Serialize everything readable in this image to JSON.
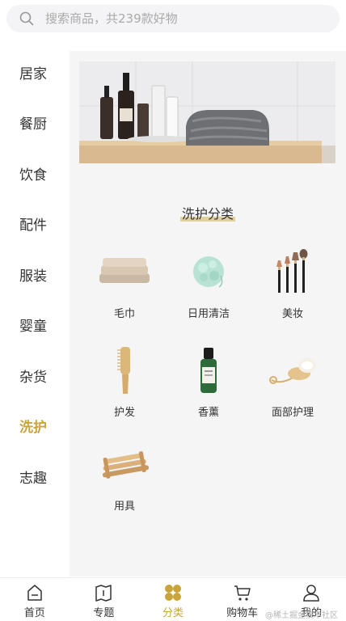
{
  "search": {
    "placeholder": "搜索商品，共239款好物"
  },
  "sidebar": {
    "items": [
      {
        "label": "居家",
        "active": false
      },
      {
        "label": "餐厨",
        "active": false
      },
      {
        "label": "饮食",
        "active": false
      },
      {
        "label": "配件",
        "active": false
      },
      {
        "label": "服装",
        "active": false
      },
      {
        "label": "婴童",
        "active": false
      },
      {
        "label": "杂货",
        "active": false
      },
      {
        "label": "洗护",
        "active": true
      },
      {
        "label": "志趣",
        "active": false
      }
    ]
  },
  "main": {
    "section_title": "洗护分类",
    "subcategories": [
      {
        "label": "毛巾",
        "icon": "towel-icon"
      },
      {
        "label": "日用清洁",
        "icon": "bath-sponge-icon"
      },
      {
        "label": "美妆",
        "icon": "makeup-brushes-icon"
      },
      {
        "label": "护发",
        "icon": "comb-icon"
      },
      {
        "label": "香薰",
        "icon": "essential-oil-icon"
      },
      {
        "label": "面部护理",
        "icon": "face-brush-icon"
      },
      {
        "label": "用具",
        "icon": "soap-dish-icon"
      }
    ]
  },
  "tabbar": {
    "tabs": [
      {
        "label": "首页",
        "icon": "home-icon",
        "active": false
      },
      {
        "label": "专题",
        "icon": "topic-book-icon",
        "active": false
      },
      {
        "label": "分类",
        "icon": "category-clover-icon",
        "active": true
      },
      {
        "label": "购物车",
        "icon": "cart-icon",
        "active": false
      },
      {
        "label": "我的",
        "icon": "user-icon",
        "active": false
      }
    ]
  },
  "watermark": "@稀土掘金技术社区",
  "colors": {
    "accent": "#c9a43a",
    "content_bg": "#f5f5f5",
    "search_bg": "#f4f4f6"
  }
}
